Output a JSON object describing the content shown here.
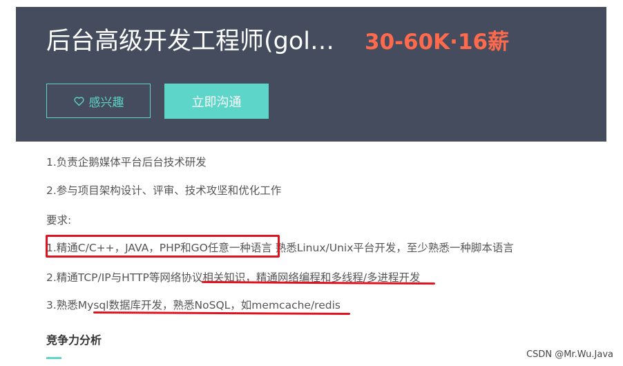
{
  "header": {
    "job_title": "后台高级开发工程师(gol…",
    "salary": "30-60K·16薪",
    "interest_button": "感兴趣",
    "chat_button": "立即沟通"
  },
  "description": {
    "lines": [
      "1.负责企鹅媒体平台后台技术研发",
      "2.参与项目架构设计、评审、技术攻坚和优化工作",
      "要求:",
      "1.精通C/C++，JAVA，PHP和GO任意一种语言  熟悉Linux/Unix平台开发，至少熟悉一种脚本语言",
      "2.精通TCP/IP与HTTP等网络协议相关知识，精通网络编程和多线程/多进程开发",
      "3.熟悉Mysql数据库开发，熟悉NoSQL，如memcache/redis"
    ]
  },
  "section": {
    "title": "竞争力分析"
  },
  "watermark": "CSDN @Mr.Wu.Java",
  "icons": {
    "interest": "heart-outline-icon"
  },
  "colors": {
    "header_bg": "#454c5e",
    "accent": "#5dd5c8",
    "salary": "#ff6a4d",
    "annotation": "#e0121e"
  }
}
